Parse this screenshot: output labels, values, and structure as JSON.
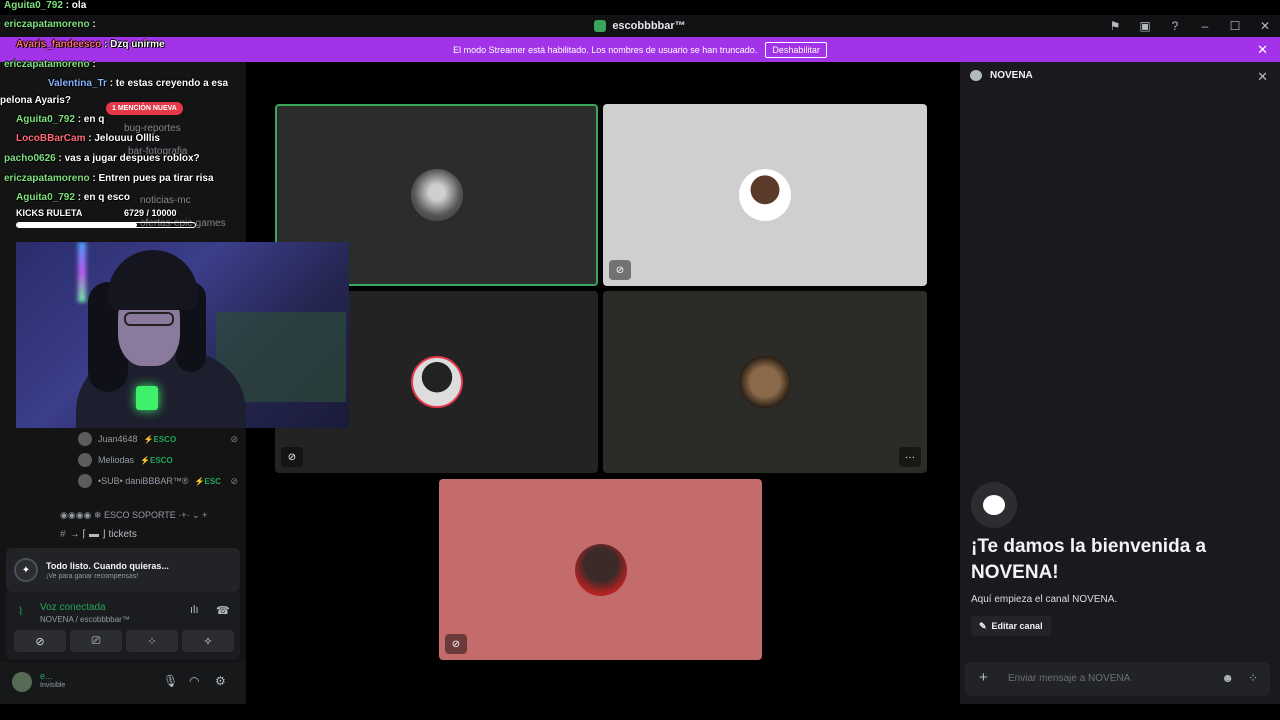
{
  "window": {
    "title": "escobbbbar™",
    "icons": [
      "⚑",
      "▣",
      "?",
      "–",
      "☐",
      "✕"
    ]
  },
  "banner": {
    "text": "El modo Streamer está habilitado. Los nombres de usuario se han truncado.",
    "button": "Deshabilitar"
  },
  "sidebar": {
    "mention_pill": "1 MENCIÓN NUEVA",
    "channels": [
      "bug-reportes",
      "bar-fotografia",
      "noticias-mc",
      "ofertas-epic-games"
    ],
    "voice_members": [
      {
        "name": "Juan4648",
        "tag": "⚡ESCO",
        "muted": "⊘"
      },
      {
        "name": "Meliodas",
        "tag": "⚡ESCO",
        "muted": ""
      },
      {
        "name": "•SUB• daniBBBAR™®",
        "tag": "⚡ESC",
        "muted": "⊘"
      }
    ],
    "category": "◉◉◉◉ ❄ ESCO SOPORTE ·+· ⌄ +",
    "tickets": "→ ⌈ ▬ ⌋ tickets",
    "notice": {
      "title": "Todo listo. Cuando quieras...",
      "subtitle": "¡Ve para ganar recompensas!"
    },
    "voice": {
      "status": "Voz conectada",
      "channel": "NOVENA / escobbbbar™"
    },
    "voice_buttons": [
      "⊘",
      "⎚",
      "⁘",
      "✧"
    ],
    "user": {
      "name": "e...",
      "status": "Invisible"
    }
  },
  "chat_overlay": {
    "messages": [
      {
        "user": "Aguita0_792",
        "text": " : ola"
      },
      {
        "user": "ericzapatamoreno",
        "text": " :"
      },
      {
        "user": "Avaris_fandeesco",
        "text": " : Dzq unirme"
      },
      {
        "user": "ericzapatamoreno",
        "text": " :"
      },
      {
        "user": "Valentina_Tr",
        "text": " : te estas creyendo a esa"
      },
      {
        "user": "",
        "text": "pelona Ayaris?"
      },
      {
        "user": "Aguita0_792",
        "text": " : en q"
      },
      {
        "user": "LocoBBarCam",
        "text": " : Jelouuu Olllis"
      },
      {
        "user": "pacho0626",
        "text": " : vas a jugar despues roblox?"
      },
      {
        "user": "ericzapatamoreno",
        "text": " : Entren pues pa tirar risa"
      },
      {
        "user": "Aguita0_792",
        "text": " : en q esco"
      }
    ],
    "kicks": {
      "label": "KICKS RULETA",
      "value": "6729 / 10000",
      "progress": 0.6729
    }
  },
  "stage": {
    "tiles": [
      {
        "name": "dog",
        "bg": "#2b2d2b",
        "muted": false
      },
      {
        "name": "guy",
        "bg": "#cfcfcf",
        "muted": true
      },
      {
        "name": "snail",
        "bg": "#232323",
        "muted": true
      },
      {
        "name": "curly",
        "bg": "#2b2c28",
        "muted": false
      },
      {
        "name": "coke",
        "bg": "#c46c6c",
        "muted": true
      }
    ]
  },
  "right_panel": {
    "channel": "NOVENA",
    "welcome": "¡Te damos la bienvenida a NOVENA!",
    "begin": "Aquí empieza el canal NOVENA.",
    "edit": "Editar canal",
    "placeholder": "Enviar mensaje a NOVENA"
  },
  "colors": {
    "accent": "#a233e8",
    "green": "#23a55a",
    "speaking": "#3ba55c"
  }
}
